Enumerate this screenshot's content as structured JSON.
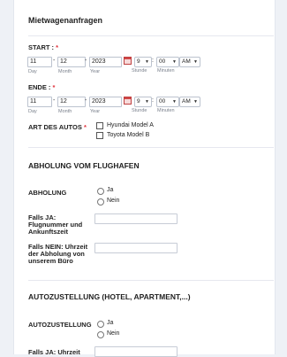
{
  "form": {
    "title": "Mietwagenanfragen",
    "start": {
      "label": "START :",
      "required": "*",
      "day": "11",
      "month": "12",
      "year": "2023",
      "hour": "9",
      "minute": "00",
      "ampm": "AM",
      "sublabels": {
        "day": "Day",
        "month": "Month",
        "year": "Year",
        "hour": "Stunde",
        "minute": "Minuten"
      }
    },
    "end": {
      "label": "ENDE :",
      "required": "*",
      "day": "11",
      "month": "12",
      "year": "2023",
      "hour": "9",
      "minute": "00",
      "ampm": "AM",
      "sublabels": {
        "day": "Day",
        "month": "Month",
        "year": "Year",
        "hour": "Stunde",
        "minute": "Minuten"
      }
    },
    "separators": {
      "date": "-",
      "time": ":"
    },
    "car_type": {
      "label": "ART DES AUTOS",
      "required": "*",
      "options": [
        "Hyundai Model A",
        "Toyota Model B"
      ]
    },
    "airport": {
      "heading": "ABHOLUNG VOM FLUGHAFEN",
      "pickup_label": "ABHOLUNG",
      "options": [
        "Ja",
        "Nein"
      ],
      "if_yes_label": "Falls JA: Flugnummer und Ankunftszeit",
      "if_no_label": "Falls NEIN: Uhrzeit der Abholung von unserem Büro"
    },
    "delivery": {
      "heading": "AUTOZUSTELLUNG (HOTEL, APARTMENT,...)",
      "label": "AUTOZUSTELLUNG",
      "options": [
        "Ja",
        "Nein"
      ],
      "if_yes_label": "Falls JA: Uhrzeit"
    }
  }
}
